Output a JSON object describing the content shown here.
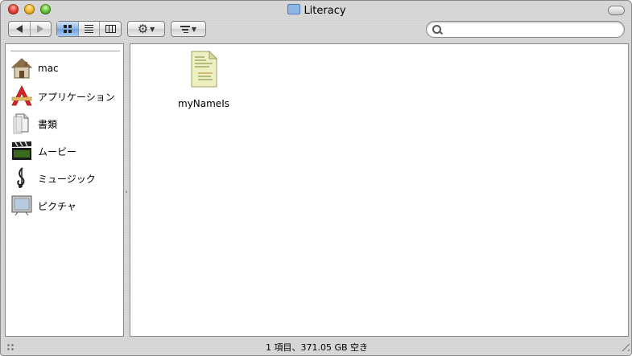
{
  "window": {
    "title": "Literacy"
  },
  "toolbar": {
    "back_icon": "back-arrow-icon",
    "forward_icon": "forward-arrow-icon",
    "view_icons": [
      "icon-view-icon",
      "list-view-icon",
      "column-view-icon"
    ],
    "selected_view": "icon",
    "action_icon": "gear-icon",
    "arrange_icon": "arrange-icon",
    "search": {
      "value": "",
      "placeholder": ""
    }
  },
  "sidebar": {
    "items": [
      {
        "label": "mac",
        "icon": "home-icon"
      },
      {
        "label": "アプリケーション",
        "icon": "applications-icon"
      },
      {
        "label": "書類",
        "icon": "documents-icon"
      },
      {
        "label": "ムービー",
        "icon": "movies-icon"
      },
      {
        "label": "ミュージック",
        "icon": "music-icon"
      },
      {
        "label": "ピクチャ",
        "icon": "pictures-icon"
      }
    ]
  },
  "content": {
    "files": [
      {
        "name": "myNameIs",
        "icon": "text-document-icon"
      }
    ]
  },
  "status": {
    "text": "1 項目、371.05 GB 空き"
  },
  "colors": {
    "selected_segment": "#8cb6e8",
    "window_frame": "#d4d4d4"
  }
}
